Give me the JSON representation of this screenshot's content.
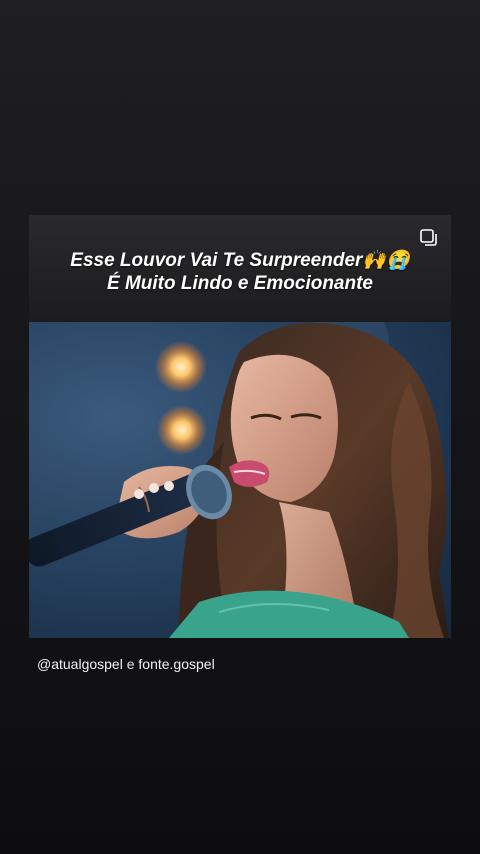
{
  "post": {
    "title_line_1": "Esse Louvor Vai Te Surpreender🙌😭",
    "title_line_2": "É Muito Lindo e Emocionante",
    "multi_icon": "multiple-posts-icon",
    "media_icon": "video-frame"
  },
  "credit": {
    "account_1": "@atualgospel",
    "conjunction": "e",
    "account_2": "fonte.gospel"
  }
}
